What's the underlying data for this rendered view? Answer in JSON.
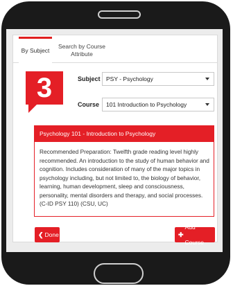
{
  "tabs": [
    {
      "label": "By Subject"
    },
    {
      "label": "Search by Course Attribute"
    }
  ],
  "step": {
    "number": "3"
  },
  "form": {
    "subject_label": "Subject",
    "subject_value": "PSY - Psychology",
    "course_label": "Course",
    "course_value": "101 Introduction to Psychology"
  },
  "course_panel": {
    "title": "Psychology 101 - Introduction to Psychology",
    "description": "Recommended Preparation:  Twelfth grade reading level highly recommended.  An introduction to the study of human behavior and cognition.  Includes consideration of many of the major topics in psychology including, but not limited to, the biology of behavior, learning, human development, sleep and consciousness, personality, mental disorders and therapy, and social processes.  (C-ID PSY 110) (CSU, UC)"
  },
  "buttons": {
    "done_label": "Done",
    "add_label": "Add Course"
  },
  "icons": {
    "done": "chevron-left-icon",
    "add": "plus-icon"
  },
  "colors": {
    "accent": "#e41f26",
    "phone": "#1a1a1a"
  }
}
